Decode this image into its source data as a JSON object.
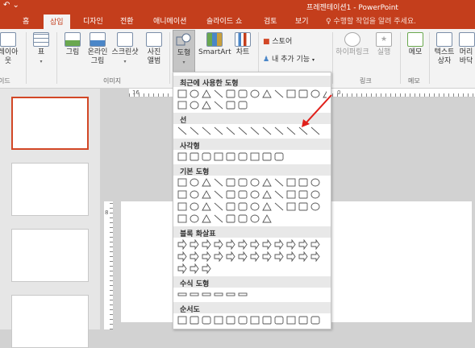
{
  "titlebar": {
    "title": "프레젠테이션1 - PowerPoint",
    "quick_access": "↶ ⌄"
  },
  "tabs": [
    {
      "label": "홈"
    },
    {
      "label": "삽입"
    },
    {
      "label": "디자인"
    },
    {
      "label": "전환"
    },
    {
      "label": "애니메이션"
    },
    {
      "label": "슬라이드 쇼"
    },
    {
      "label": "검토"
    },
    {
      "label": "보기"
    }
  ],
  "tellme": "수행할 작업을 알려 주세요.",
  "ribbon": {
    "layout": "레이아웃",
    "table": "표",
    "picture": "그림",
    "online_picture": "온라인 그림",
    "screenshot": "스크린샷",
    "album": "사진 앨범",
    "shapes": "도형",
    "smartart": "SmartArt",
    "chart": "차트",
    "store": "스토어",
    "my_addins": "내 추가 기능",
    "hyperlink": "하이퍼링크",
    "action": "실행",
    "comment": "메모",
    "textbox": "텍스트 상자",
    "header": "머리 바닥",
    "groups": {
      "slide": "이드",
      "image": "이미지",
      "link": "링크",
      "comment": "메모"
    }
  },
  "dropdown": {
    "sections": [
      {
        "title": "최근에 사용한 도형"
      },
      {
        "title": "선"
      },
      {
        "title": "사각형"
      },
      {
        "title": "기본 도형"
      },
      {
        "title": "블록 화살표"
      },
      {
        "title": "수식 도형"
      },
      {
        "title": "순서도"
      }
    ]
  },
  "ruler": {
    "h_left": "16",
    "h_mid": "0",
    "v_mark": "8"
  },
  "colors": {
    "accent": "#c43e1c",
    "annotation_arrow": "#e0201b"
  }
}
